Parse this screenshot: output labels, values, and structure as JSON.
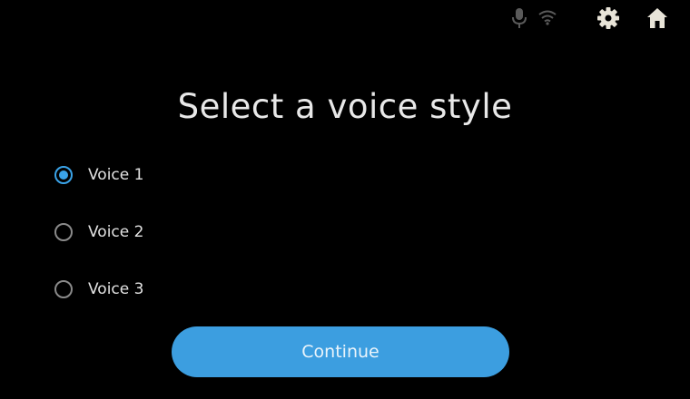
{
  "status_bar": {
    "icons": [
      "mic-icon",
      "wifi-icon",
      "gear-icon",
      "home-icon"
    ]
  },
  "title": "Select a voice style",
  "options": [
    {
      "label": "Voice 1",
      "selected": true
    },
    {
      "label": "Voice 2",
      "selected": false
    },
    {
      "label": "Voice 3",
      "selected": false
    }
  ],
  "continue_label": "Continue",
  "colors": {
    "accent": "#3aa3e8",
    "button": "#3c9ee0",
    "background": "#000000",
    "radio_unselected": "#8a8a8a",
    "icon_dim": "#5a5a5a",
    "icon_bright": "#e8e4d8"
  }
}
